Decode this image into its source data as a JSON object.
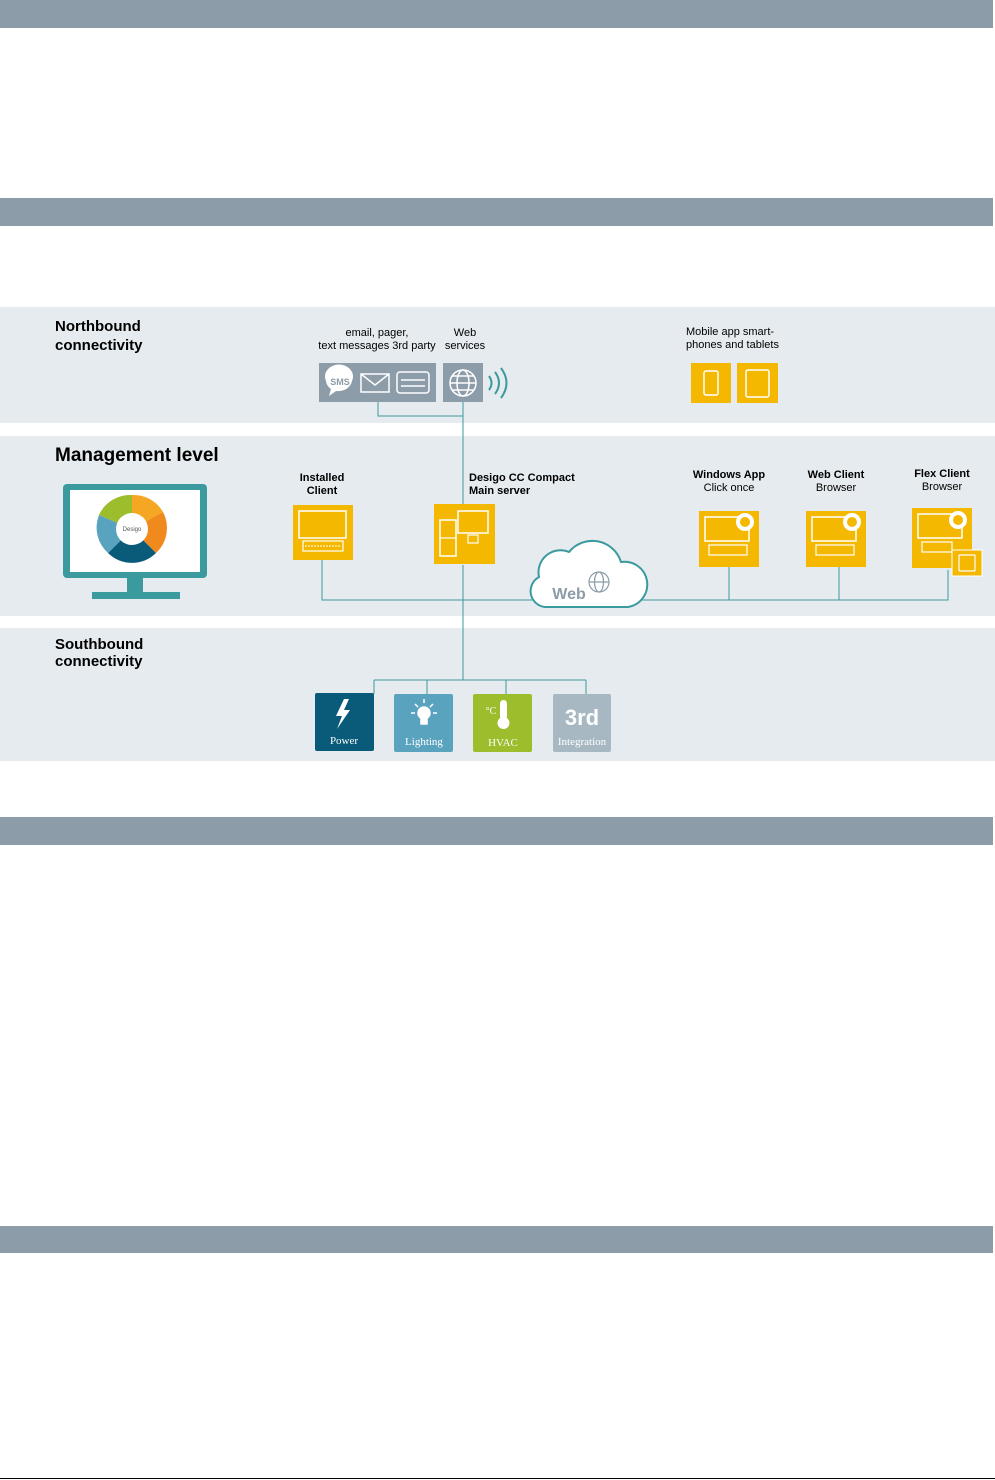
{
  "northbound": {
    "title_line1": "Northbound",
    "title_line2": "connectivity"
  },
  "management": {
    "title": "Management level"
  },
  "southbound": {
    "title_line1": "Southbound",
    "title_line2": "connectivity"
  },
  "nodes": {
    "notify_line1": "email, pager,",
    "notify_line2": "text messages 3rd party",
    "web_services_line1": "Web",
    "web_services_line2": "services",
    "mobile_line1": "Mobile app smart-",
    "mobile_line2": "phones and tablets",
    "installed_line1": "Installed",
    "installed_line2": "Client",
    "server_line1": "Desigo CC Compact",
    "server_line2": "Main server",
    "windows_line1": "Windows App",
    "windows_line2": "Click once",
    "webclient_line1": "Web Client",
    "webclient_line2": "Browser",
    "flex_line1": "Flex Client",
    "flex_line2": "Browser",
    "cloud": "Web",
    "sms": "SMS",
    "logo": "Desigo"
  },
  "subsystems": {
    "power": "Power",
    "lighting": "Lighting",
    "hvac": "HVAC",
    "hvac_unit": "°C",
    "third_big": "3rd",
    "third": "Integration"
  },
  "colors": {
    "bar": "#8c9ca8",
    "band": "#e6ebef",
    "orange": "#f5b800",
    "teal": "#3a9a9e",
    "power": "#0a5a7a",
    "lighting": "#5aa3bf",
    "hvac": "#9cbd2c",
    "third": "#a7b8c3",
    "line": "#3a9a9e"
  }
}
